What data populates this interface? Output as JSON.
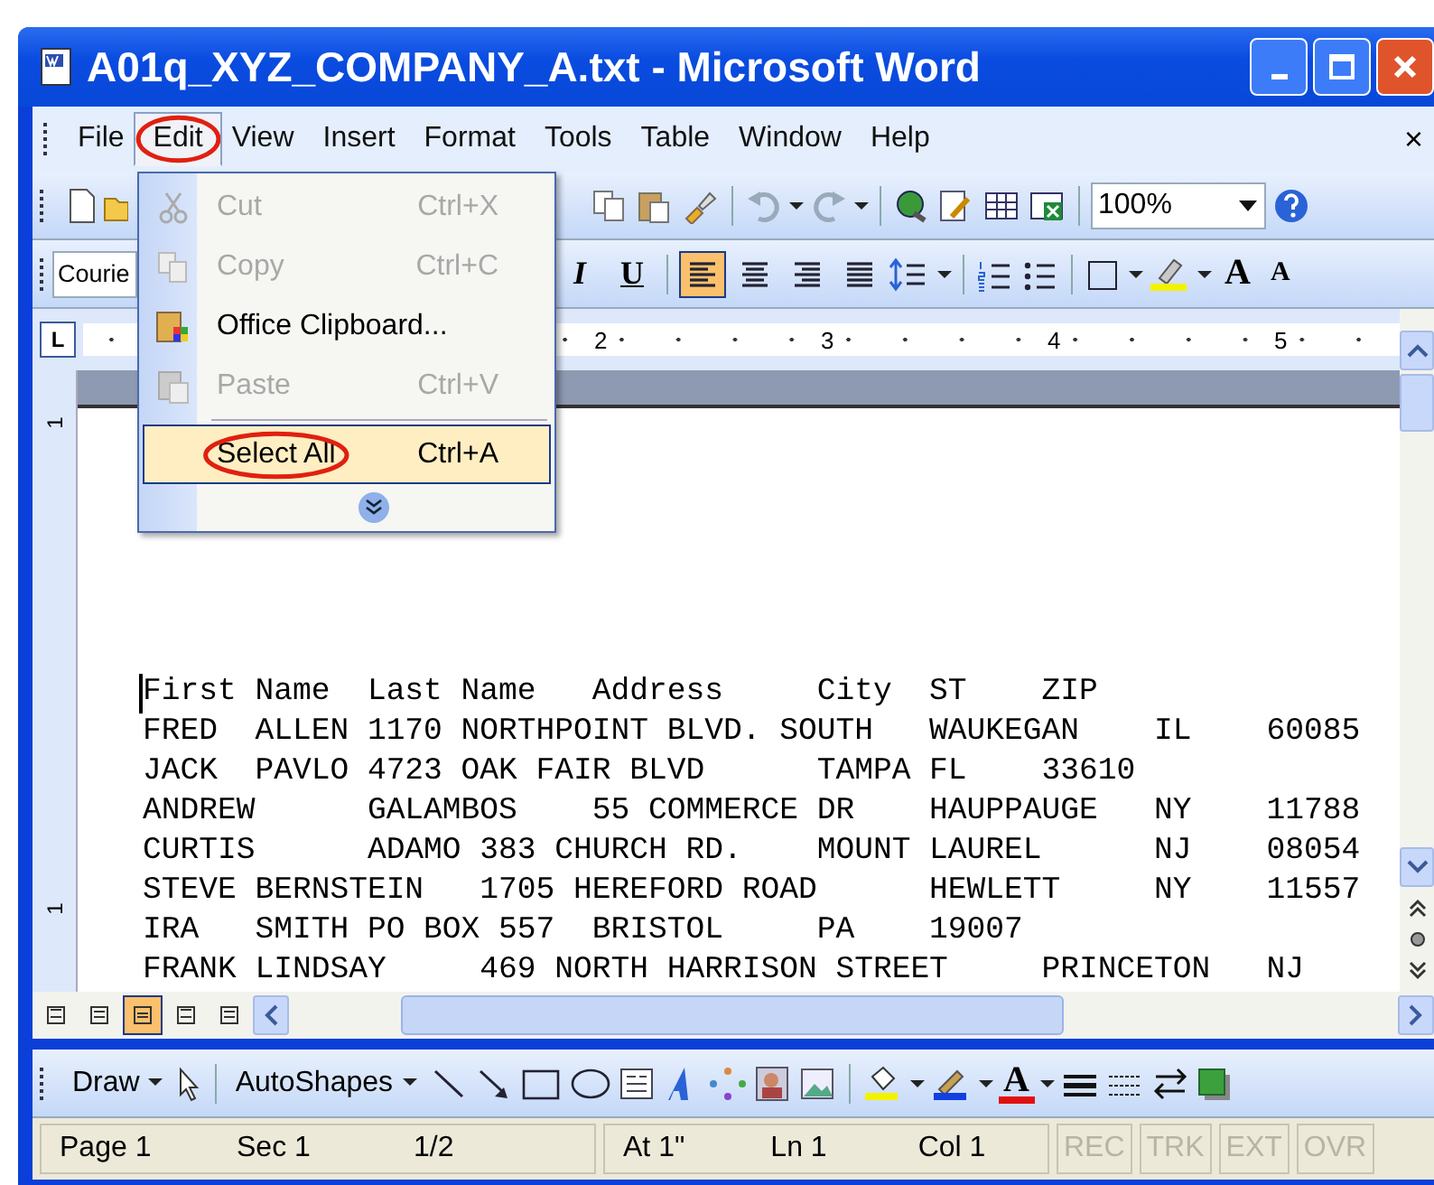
{
  "window": {
    "title": "A01q_XYZ_COMPANY_A.txt - Microsoft Word"
  },
  "menu_bar": {
    "items": [
      {
        "label": "File",
        "selected": false,
        "circled": false
      },
      {
        "label": "Edit",
        "selected": true,
        "circled": true
      },
      {
        "label": "View",
        "selected": false,
        "circled": false
      },
      {
        "label": "Insert",
        "selected": false,
        "circled": false
      },
      {
        "label": "Format",
        "selected": false,
        "circled": false
      },
      {
        "label": "Tools",
        "selected": false,
        "circled": false
      },
      {
        "label": "Table",
        "selected": false,
        "circled": false
      },
      {
        "label": "Window",
        "selected": false,
        "circled": false
      },
      {
        "label": "Help",
        "selected": false,
        "circled": false
      }
    ],
    "close_label": "×"
  },
  "edit_menu": {
    "items": [
      {
        "kind": "item",
        "label": "Cut",
        "shortcut": "Ctrl+X",
        "disabled": true,
        "selected": false,
        "circled": false
      },
      {
        "kind": "item",
        "label": "Copy",
        "shortcut": "Ctrl+C",
        "disabled": true,
        "selected": false,
        "circled": false
      },
      {
        "kind": "item",
        "label": "Office Clipboard...",
        "disabled": false,
        "selected": false,
        "circled": false
      },
      {
        "kind": "item",
        "label": "Paste",
        "shortcut": "Ctrl+V",
        "disabled": true,
        "selected": false,
        "circled": false
      },
      {
        "kind": "separator"
      },
      {
        "kind": "item",
        "label": "Select All",
        "shortcut": "Ctrl+A",
        "disabled": false,
        "selected": true,
        "circled": true
      },
      {
        "kind": "expand"
      }
    ]
  },
  "standard_toolbar": {
    "zoom": "100%"
  },
  "formatting_toolbar": {
    "font": "Courie",
    "style_buttons": [
      {
        "label": "I",
        "kind": "italic"
      },
      {
        "label": "U",
        "kind": "underline"
      }
    ],
    "align_buttons": [
      {
        "kind": "left",
        "selected": true
      },
      {
        "kind": "center",
        "selected": false
      },
      {
        "kind": "right",
        "selected": false
      },
      {
        "kind": "justify",
        "selected": false
      }
    ],
    "size_buttons": [
      {
        "label": "A",
        "kind": "grow"
      },
      {
        "label": "A",
        "kind": "shrink"
      }
    ]
  },
  "ruler": {
    "tab_stop": "L",
    "numbers": [
      "2",
      "3",
      "4",
      "5"
    ]
  },
  "vertical_ruler": {
    "numbers": [
      "1",
      "1"
    ]
  },
  "document": {
    "lines": [
      "First Name  Last Name   Address     City  ST    ZIP",
      "FRED  ALLEN 1170 NORTHPOINT BLVD. SOUTH   WAUKEGAN    IL    60085",
      "JACK  PAVLO 4723 OAK FAIR BLVD      TAMPA FL    33610",
      "ANDREW      GALAMBOS    55 COMMERCE DR    HAUPPAUGE   NY    11788",
      "CURTIS      ADAMO 383 CHURCH RD.    MOUNT LAUREL      NJ    08054",
      "STEVE BERNSTEIN   1705 HEREFORD ROAD      HEWLETT     NY    11557",
      "IRA   SMITH PO BOX 557  BRISTOL     PA    19007",
      "FRANK LINDSAY     469 NORTH HARRISON STREET     PRINCETON   NJ"
    ]
  },
  "view_buttons": [
    {
      "selected": false
    },
    {
      "selected": false
    },
    {
      "selected": true
    },
    {
      "selected": false
    },
    {
      "selected": false
    }
  ],
  "drawing_toolbar": {
    "draw": "Draw",
    "autoshapes": "AutoShapes",
    "font_color_label": "A"
  },
  "status_bar": {
    "fields": [
      {
        "label": "Page 1",
        "disabled": false
      },
      {
        "label": "Sec 1",
        "disabled": false
      },
      {
        "label": "1/2",
        "disabled": false
      },
      {
        "label": "At 1\"",
        "disabled": false
      },
      {
        "label": "Ln 1",
        "disabled": false
      },
      {
        "label": "Col 1",
        "disabled": false
      }
    ],
    "modes": [
      {
        "label": "REC",
        "disabled": true
      },
      {
        "label": "TRK",
        "disabled": true
      },
      {
        "label": "EXT",
        "disabled": true
      },
      {
        "label": "OVR",
        "disabled": true
      }
    ]
  }
}
